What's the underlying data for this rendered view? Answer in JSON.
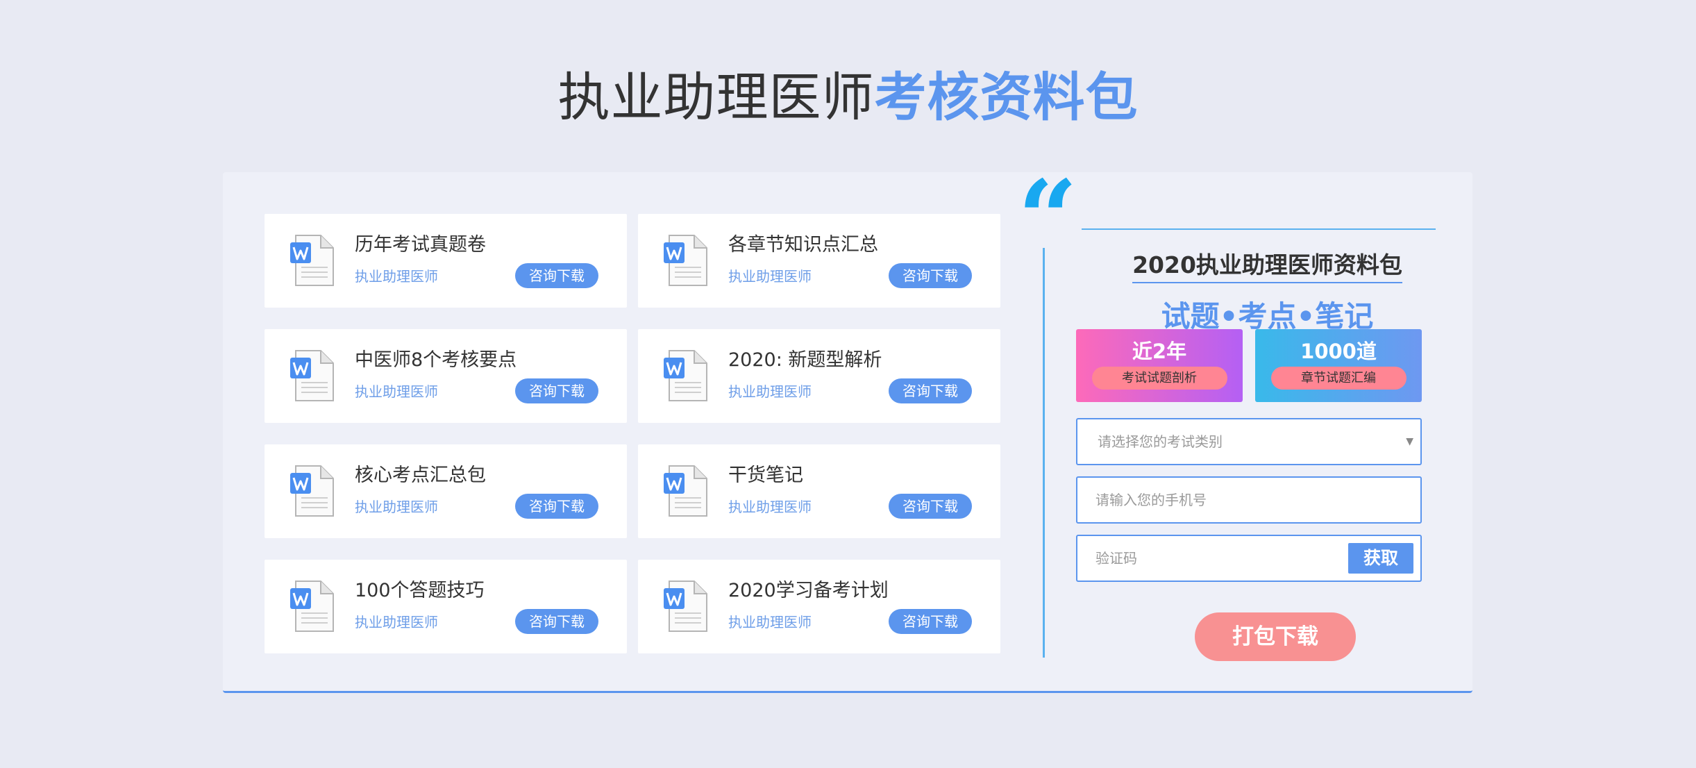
{
  "heading": {
    "dark": "执业助理医师",
    "accent": "考核资料包"
  },
  "cards": [
    {
      "title": "历年考试真题卷",
      "subtitle": "执业助理医师",
      "button": "咨询下载"
    },
    {
      "title": "各章节知识点汇总",
      "subtitle": "执业助理医师",
      "button": "咨询下载"
    },
    {
      "title": "中医师8个考核要点",
      "subtitle": "执业助理医师",
      "button": "咨询下载"
    },
    {
      "title": "2020: 新题型解析",
      "subtitle": "执业助理医师",
      "button": "咨询下载"
    },
    {
      "title": "核心考点汇总包",
      "subtitle": "执业助理医师",
      "button": "咨询下载"
    },
    {
      "title": "干货笔记",
      "subtitle": "执业助理医师",
      "button": "咨询下载"
    },
    {
      "title": "100个答题技巧",
      "subtitle": "执业助理医师",
      "button": "咨询下载"
    },
    {
      "title": "2020学习备考计划",
      "subtitle": "执业助理医师",
      "button": "咨询下载"
    }
  ],
  "side": {
    "quote_glyph": "“",
    "title": "2020执业助理医师资料包",
    "subtitle": "试题•考点•笔记",
    "promo_left": {
      "number": "近2年",
      "label": "考试试题剖析"
    },
    "promo_right": {
      "number": "1000道",
      "label": "章节试题汇编"
    },
    "exam_select": {
      "selected_text": "请选择您的考试类别",
      "arrow": "▼"
    },
    "phone_input": {
      "placeholder": "请输入您的手机号"
    },
    "code_input": {
      "placeholder": "验证码",
      "button": "获取"
    },
    "download_button": "打包下载"
  },
  "icons": {
    "document": "word-document-icon",
    "quote": "quote-icon",
    "dropdown": "dropdown-arrow-icon"
  },
  "colors": {
    "accent": "#5b95ee",
    "pink": "#f89192",
    "quote": "#19a8f0",
    "background": "#e8eaf3"
  }
}
